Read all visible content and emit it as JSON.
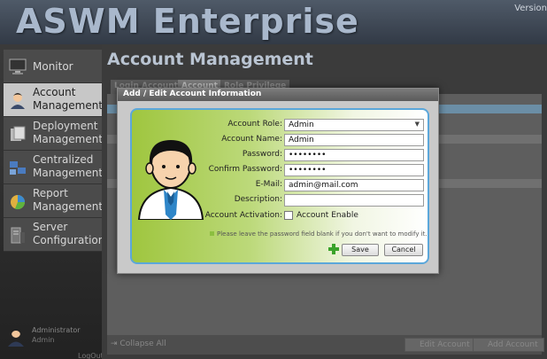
{
  "header": {
    "title": "ASWM Enterprise",
    "version": "Version"
  },
  "sidebar": {
    "items": [
      {
        "label": "Monitor",
        "icon": "monitor-icon"
      },
      {
        "label_line1": "Account",
        "label_line2": "Management",
        "icon": "user-icon"
      },
      {
        "label_line1": "Deployment",
        "label_line2": "Management",
        "icon": "deployment-icon"
      },
      {
        "label_line1": "Centralized",
        "label_line2": "Management",
        "icon": "centralized-icon"
      },
      {
        "label_line1": "Report",
        "label_line2": "Management",
        "icon": "report-icon"
      },
      {
        "label_line1": "Server",
        "label_line2": "Configuration",
        "icon": "server-icon"
      }
    ],
    "user": {
      "name": "Administrator",
      "role": "Admin"
    },
    "logout": "LogOut"
  },
  "main": {
    "title": "Account Management",
    "tabs": [
      "Login Account",
      "Account",
      "Role Privilege"
    ],
    "footer": {
      "collapse": "Collapse All",
      "edit": "Edit Account",
      "add": "Add Account"
    }
  },
  "dialog": {
    "title": "Add / Edit Account Information",
    "fields": {
      "role": {
        "label": "Account Role:",
        "value": "Admin"
      },
      "name": {
        "label": "Account Name:",
        "value": "Admin"
      },
      "password": {
        "label": "Password:",
        "value": "••••••••"
      },
      "confirm": {
        "label": "Confirm Password:",
        "value": "••••••••"
      },
      "email": {
        "label": "E-Mail:",
        "value": "admin@mail.com"
      },
      "description": {
        "label": "Description:",
        "value": ""
      },
      "activation": {
        "label": "Account Activation:",
        "checkbox_label": "Account Enable"
      }
    },
    "hint": "Please leave the password field blank if you don't want to modify it.",
    "save_label": "Save",
    "cancel_label": "Cancel"
  },
  "colors": {
    "accent_green": "#9fc63f",
    "panel_border": "#5ba7da"
  }
}
